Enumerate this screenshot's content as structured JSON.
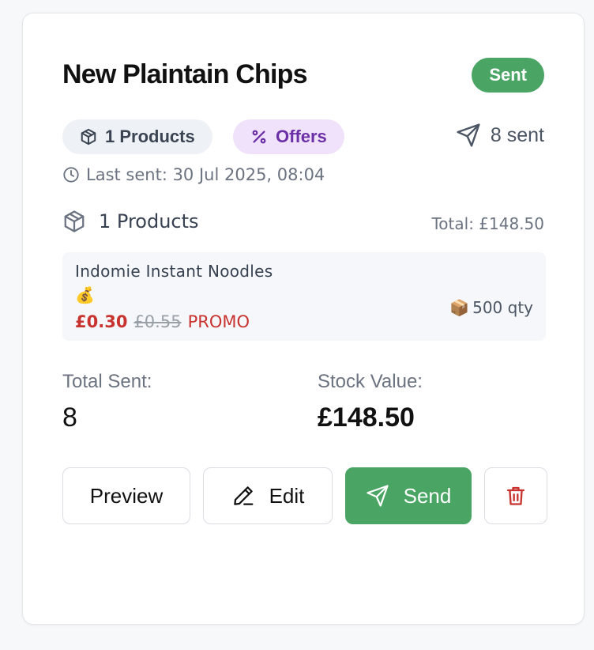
{
  "card": {
    "title": "New Plaintain Chips",
    "status": "Sent",
    "chips": {
      "products": "1 Products",
      "offers": "Offers"
    },
    "sent_count": "8 sent",
    "last_sent": "Last sent: 30 Jul 2025, 08:04",
    "products_section": {
      "label": "1 Products",
      "total": "Total: £148.50",
      "items": [
        {
          "name": "Indomie Instant Noodles",
          "emoji": "💰",
          "price": "£0.30",
          "old_price": "£0.55",
          "tag": "PROMO",
          "qty_icon": "📦",
          "qty": "500 qty"
        }
      ]
    },
    "stats": {
      "total_sent_label": "Total Sent:",
      "total_sent_value": "8",
      "stock_value_label": "Stock Value:",
      "stock_value": "£148.50"
    },
    "actions": {
      "preview": "Preview",
      "edit": "Edit",
      "send": "Send"
    }
  },
  "colors": {
    "accent_green": "#4aa564",
    "promo_red": "#c8322f",
    "offers_purple": "#6b2fa6"
  }
}
